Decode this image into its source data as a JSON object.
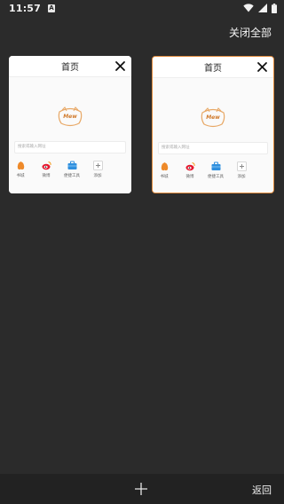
{
  "status": {
    "time": "11:57",
    "app_icon": "A"
  },
  "header": {
    "close_all_label": "关闭全部"
  },
  "tabs": [
    {
      "title": "首页",
      "logo_text": "Mew",
      "search_placeholder": "搜索或输入网址",
      "shortcuts": [
        {
          "label": "书城",
          "icon": "book-icon"
        },
        {
          "label": "微博",
          "icon": "weibo-icon"
        },
        {
          "label": "便捷工具",
          "icon": "toolbox-icon"
        },
        {
          "label": "添加",
          "icon": "add-icon"
        }
      ]
    },
    {
      "title": "首页",
      "logo_text": "Mew",
      "search_placeholder": "搜索或输入网址",
      "shortcuts": [
        {
          "label": "书城",
          "icon": "book-icon"
        },
        {
          "label": "微博",
          "icon": "weibo-icon"
        },
        {
          "label": "便捷工具",
          "icon": "toolbox-icon"
        },
        {
          "label": "添加",
          "icon": "add-icon"
        }
      ]
    }
  ],
  "bottom": {
    "back_label": "返回",
    "add_icon": "plus-icon"
  },
  "colors": {
    "background": "#2b2b2b",
    "active_border": "#e08a3c",
    "bottom_bar": "#222222"
  }
}
